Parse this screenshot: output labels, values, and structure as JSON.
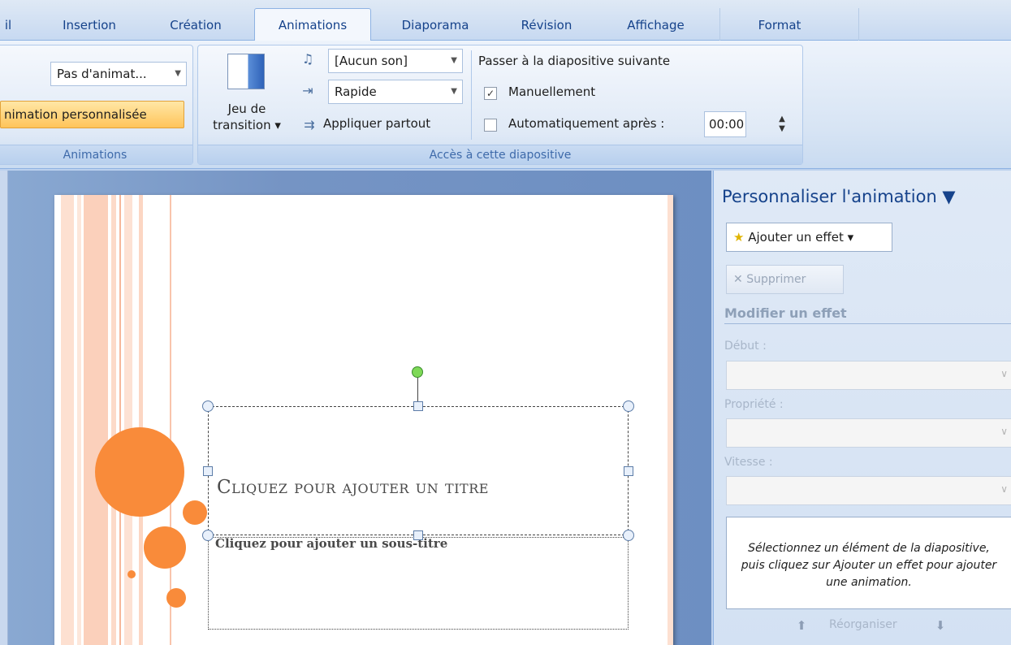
{
  "tabs": [
    {
      "label": "il"
    },
    {
      "label": "Insertion"
    },
    {
      "label": "Création"
    },
    {
      "label": "Animations"
    },
    {
      "label": "Diaporama"
    },
    {
      "label": "Révision"
    },
    {
      "label": "Affichage"
    },
    {
      "label": "Format"
    }
  ],
  "ribbon": {
    "animations_group": {
      "combo_value": "Pas d'animat...",
      "custom_anim_button": "nimation personnalisée",
      "label": "Animations"
    },
    "transition_group": {
      "transition_button": "Jeu de transition",
      "transition_line1": "Jeu de",
      "transition_line2": "transition ▾",
      "sound_combo": "[Aucun son]",
      "speed_combo": "Rapide",
      "apply_all": "Appliquer partout",
      "next_slide_heading": "Passer à la diapositive suivante",
      "manual_label": "Manuellement",
      "manual_checked": true,
      "auto_label": "Automatiquement après :",
      "auto_checked": false,
      "time_value": "00:00",
      "label": "Accès à cette diapositive"
    }
  },
  "slide": {
    "title": "Cliquez pour ajouter un titre",
    "subtitle": "Cliquez pour ajouter un sous-titre",
    "accent_color": "#f98b3a"
  },
  "taskpane": {
    "title": "Personnaliser l'animation ▼",
    "add_effect": "Ajouter un effet ▾",
    "remove": "Supprimer",
    "section": "Modifier un effet",
    "start_label": "Début :",
    "property_label": "Propriété :",
    "speed_label": "Vitesse :",
    "hint": "Sélectionnez un élément de la diapositive, puis cliquez sur Ajouter un effet pour ajouter une animation.",
    "reorder": "Réorganiser"
  }
}
